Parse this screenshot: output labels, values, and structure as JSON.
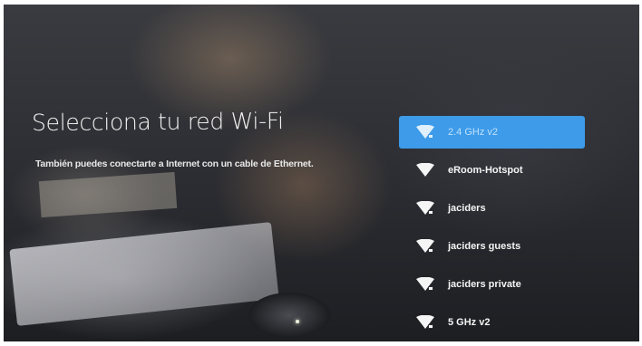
{
  "page": {
    "title": "Selecciona tu red Wi-Fi",
    "subtitle": "También puedes conectarte a Internet con un cable de Ethernet."
  },
  "networks": [
    {
      "name": "2.4 GHz v2",
      "selected": true,
      "locked": true
    },
    {
      "name": "eRoom-Hotspot",
      "selected": false,
      "locked": false
    },
    {
      "name": "jaciders",
      "selected": false,
      "locked": true
    },
    {
      "name": "jaciders guests",
      "selected": false,
      "locked": true
    },
    {
      "name": "jaciders private",
      "selected": false,
      "locked": true
    },
    {
      "name": "5 GHz v2",
      "selected": false,
      "locked": true
    }
  ],
  "colors": {
    "selected_bg": "#3d9be9",
    "text": "#f5f5f5"
  },
  "icons": {
    "network": "wifi-signal-icon",
    "secured": "lock-icon"
  }
}
